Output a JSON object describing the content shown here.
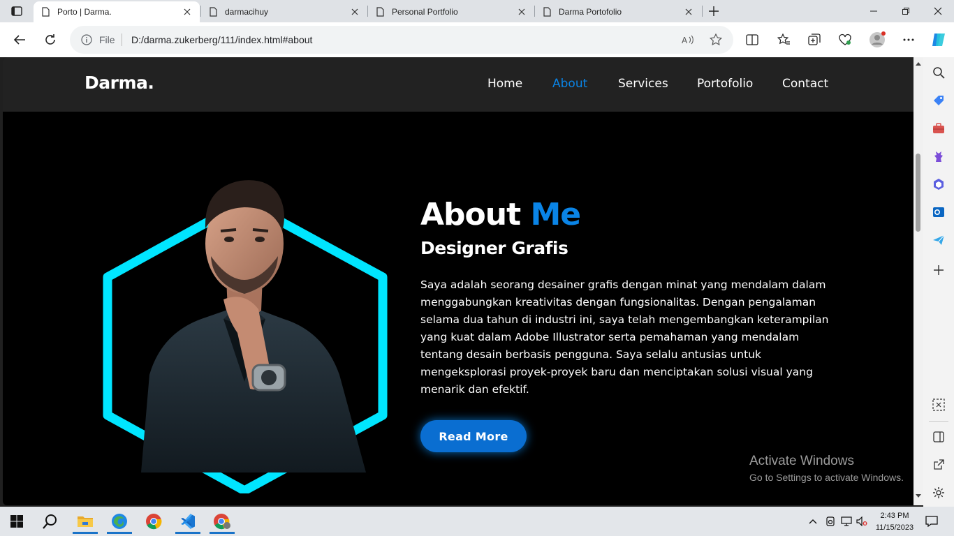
{
  "browser": {
    "tabs": [
      {
        "title": "Porto | Darma.",
        "active": true
      },
      {
        "title": "darmacihuy",
        "active": false
      },
      {
        "title": "Personal Portfolio",
        "active": false
      },
      {
        "title": "Darma Portofolio",
        "active": false
      }
    ],
    "address": {
      "scheme_label": "File",
      "url": "D:/darma.zukerberg/111/index.html#about"
    }
  },
  "site": {
    "logo": "Darma.",
    "nav": [
      "Home",
      "About",
      "Services",
      "Portofolio",
      "Contact"
    ],
    "active_nav": "About",
    "about": {
      "title_main": "About ",
      "title_accent": "Me",
      "subtitle": "Designer Grafis",
      "paragraph": "Saya adalah seorang desainer grafis dengan minat yang mendalam dalam menggabungkan kreativitas dengan fungsionalitas. Dengan pengalaman selama dua tahun di industri ini, saya telah mengembangkan keterampilan yang kuat dalam Adobe Illustrator serta pemahaman yang mendalam tentang desain berbasis pengguna. Saya selalu antusias untuk mengeksplorasi proyek-proyek baru dan menciptakan solusi visual yang menarik dan efektif.",
      "button": "Read More"
    },
    "colors": {
      "accent": "#0a84e6",
      "hexagon": "#00e5ff",
      "header_bg": "#222222",
      "page_bg": "#000000"
    }
  },
  "watermark": {
    "line1": "Activate Windows",
    "line2": "Go to Settings to activate Windows."
  },
  "taskbar": {
    "time": "2:43 PM",
    "date": "11/15/2023"
  }
}
